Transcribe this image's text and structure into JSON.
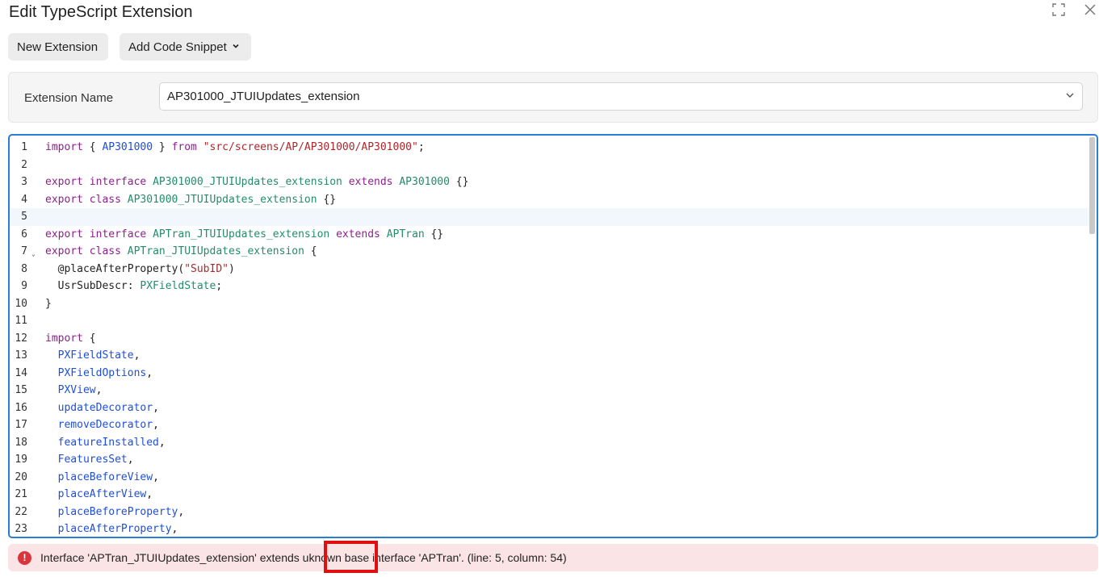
{
  "dialog": {
    "title": "Edit TypeScript Extension",
    "maximize_icon": "maximize-icon",
    "close_icon": "close-icon"
  },
  "toolbar": {
    "new_extension_label": "New Extension",
    "add_snippet_label": "Add Code Snippet"
  },
  "extension": {
    "name_label": "Extension Name",
    "name_value": "AP301000_JTUIUpdates_extension"
  },
  "editor": {
    "active_line": 5,
    "lines": [
      {
        "n": "1",
        "tokens": [
          [
            "kw",
            "import"
          ],
          [
            "pl",
            " { "
          ],
          [
            "id",
            "AP301000"
          ],
          [
            "pl",
            " } "
          ],
          [
            "kw",
            "from"
          ],
          [
            "pl",
            " "
          ],
          [
            "st",
            "\"src/screens/AP/AP301000/AP301000\""
          ],
          [
            "pl",
            ";"
          ]
        ]
      },
      {
        "n": "2",
        "tokens": []
      },
      {
        "n": "3",
        "tokens": [
          [
            "kw",
            "export"
          ],
          [
            "pl",
            " "
          ],
          [
            "kw",
            "interface"
          ],
          [
            "pl",
            " "
          ],
          [
            "ty",
            "AP301000_JTUIUpdates_extension"
          ],
          [
            "pl",
            " "
          ],
          [
            "kw",
            "extends"
          ],
          [
            "pl",
            " "
          ],
          [
            "ty",
            "AP301000"
          ],
          [
            "pl",
            " {}"
          ]
        ]
      },
      {
        "n": "4",
        "tokens": [
          [
            "kw",
            "export"
          ],
          [
            "pl",
            " "
          ],
          [
            "kw",
            "class"
          ],
          [
            "pl",
            " "
          ],
          [
            "ty",
            "AP301000_JTUIUpdates_extension"
          ],
          [
            "pl",
            " {}"
          ]
        ]
      },
      {
        "n": "5",
        "tokens": []
      },
      {
        "n": "6",
        "tokens": [
          [
            "kw",
            "export"
          ],
          [
            "pl",
            " "
          ],
          [
            "kw",
            "interface"
          ],
          [
            "pl",
            " "
          ],
          [
            "ty",
            "APTran_JTUIUpdates_extension"
          ],
          [
            "pl",
            " "
          ],
          [
            "kw",
            "extends"
          ],
          [
            "pl",
            " "
          ],
          [
            "ty",
            "APTran"
          ],
          [
            "pl",
            " {}"
          ]
        ]
      },
      {
        "n": "7",
        "fold": true,
        "tokens": [
          [
            "kw",
            "export"
          ],
          [
            "pl",
            " "
          ],
          [
            "kw",
            "class"
          ],
          [
            "pl",
            " "
          ],
          [
            "ty",
            "APTran_JTUIUpdates_extension"
          ],
          [
            "pl",
            " {"
          ]
        ]
      },
      {
        "n": "8",
        "tokens": [
          [
            "pl",
            "  @placeAfterProperty("
          ],
          [
            "st",
            "\"SubID\""
          ],
          [
            "pl",
            ")"
          ]
        ]
      },
      {
        "n": "9",
        "tokens": [
          [
            "pl",
            "  UsrSubDescr: "
          ],
          [
            "ty",
            "PXFieldState"
          ],
          [
            "pl",
            ";"
          ]
        ]
      },
      {
        "n": "10",
        "tokens": [
          [
            "pl",
            "}"
          ]
        ]
      },
      {
        "n": "11",
        "tokens": []
      },
      {
        "n": "12",
        "tokens": [
          [
            "kw",
            "import"
          ],
          [
            "pl",
            " {"
          ]
        ]
      },
      {
        "n": "13",
        "tokens": [
          [
            "pl",
            "  "
          ],
          [
            "id",
            "PXFieldState"
          ],
          [
            "pl",
            ","
          ]
        ]
      },
      {
        "n": "14",
        "tokens": [
          [
            "pl",
            "  "
          ],
          [
            "id",
            "PXFieldOptions"
          ],
          [
            "pl",
            ","
          ]
        ]
      },
      {
        "n": "15",
        "tokens": [
          [
            "pl",
            "  "
          ],
          [
            "id",
            "PXView"
          ],
          [
            "pl",
            ","
          ]
        ]
      },
      {
        "n": "16",
        "tokens": [
          [
            "pl",
            "  "
          ],
          [
            "id",
            "updateDecorator"
          ],
          [
            "pl",
            ","
          ]
        ]
      },
      {
        "n": "17",
        "tokens": [
          [
            "pl",
            "  "
          ],
          [
            "id",
            "removeDecorator"
          ],
          [
            "pl",
            ","
          ]
        ]
      },
      {
        "n": "18",
        "tokens": [
          [
            "pl",
            "  "
          ],
          [
            "id",
            "featureInstalled"
          ],
          [
            "pl",
            ","
          ]
        ]
      },
      {
        "n": "19",
        "tokens": [
          [
            "pl",
            "  "
          ],
          [
            "id",
            "FeaturesSet"
          ],
          [
            "pl",
            ","
          ]
        ]
      },
      {
        "n": "20",
        "tokens": [
          [
            "pl",
            "  "
          ],
          [
            "id",
            "placeBeforeView"
          ],
          [
            "pl",
            ","
          ]
        ]
      },
      {
        "n": "21",
        "tokens": [
          [
            "pl",
            "  "
          ],
          [
            "id",
            "placeAfterView"
          ],
          [
            "pl",
            ","
          ]
        ]
      },
      {
        "n": "22",
        "tokens": [
          [
            "pl",
            "  "
          ],
          [
            "id",
            "placeBeforeProperty"
          ],
          [
            "pl",
            ","
          ]
        ]
      },
      {
        "n": "23",
        "tokens": [
          [
            "pl",
            "  "
          ],
          [
            "id",
            "placeAfterProperty"
          ],
          [
            "pl",
            ","
          ]
        ]
      }
    ]
  },
  "error": {
    "icon": "error-icon",
    "message": "Interface 'APTran_JTUIUpdates_extension' extends uknown base interface 'APTran'. (line: 5, column: 54)"
  }
}
